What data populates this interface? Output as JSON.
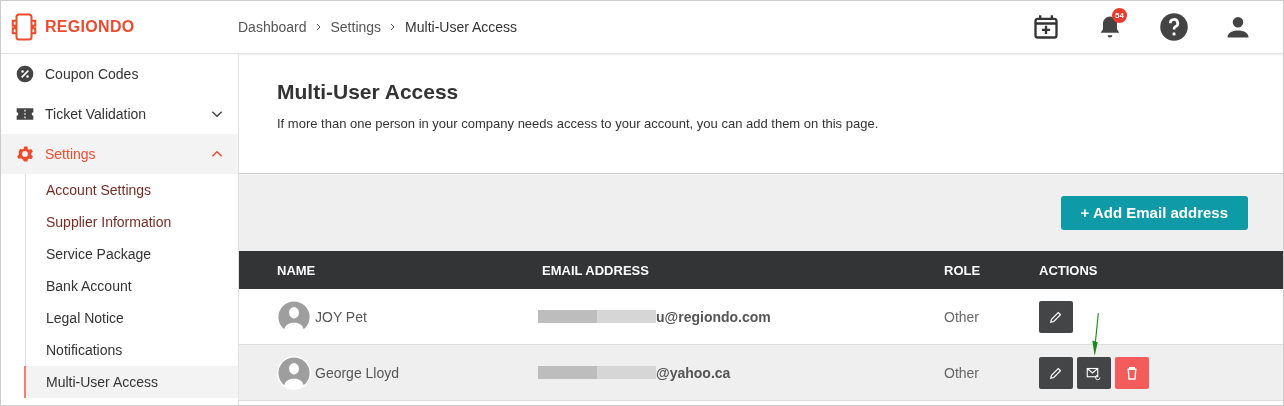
{
  "header": {
    "logo": "REGIONDO",
    "breadcrumbs": [
      "Dashboard",
      "Settings",
      "Multi-User Access"
    ],
    "notification_count": "54"
  },
  "sidebar": {
    "items": [
      {
        "label": "Coupon Codes",
        "kind": "percent",
        "selected": false
      },
      {
        "label": "Ticket Validation",
        "kind": "ticket",
        "selected": false,
        "expanded": false
      },
      {
        "label": "Settings",
        "kind": "gear",
        "selected": true,
        "expanded": true,
        "children": [
          {
            "label": "Account Settings",
            "visited": true,
            "selected": false
          },
          {
            "label": "Supplier Information",
            "visited": true,
            "selected": false
          },
          {
            "label": "Service Package",
            "visited": false,
            "selected": false
          },
          {
            "label": "Bank Account",
            "visited": false,
            "selected": false
          },
          {
            "label": "Legal Notice",
            "visited": false,
            "selected": false
          },
          {
            "label": "Notifications",
            "visited": false,
            "selected": false
          },
          {
            "label": "Multi-User Access",
            "visited": false,
            "selected": true
          }
        ]
      }
    ]
  },
  "page": {
    "title": "Multi-User Access",
    "description": "If more than one person in your company needs access to your account, you can add them on this page.",
    "add_button": "+ Add Email address"
  },
  "table": {
    "columns": [
      "NAME",
      "EMAIL ADDRESS",
      "ROLE",
      "ACTIONS"
    ],
    "rows": [
      {
        "name": "JOY Pet",
        "email": "u@regiondo.com",
        "redacted": true,
        "role": "Other",
        "actions": [
          {
            "kind": "edit",
            "pointed": false
          }
        ]
      },
      {
        "name": "George Lloyd",
        "email": "@yahoo.ca",
        "redacted": true,
        "role": "Other",
        "actions": [
          {
            "kind": "edit",
            "pointed": false
          },
          {
            "kind": "resend",
            "pointed": true
          },
          {
            "kind": "delete",
            "pointed": false
          }
        ]
      }
    ]
  }
}
